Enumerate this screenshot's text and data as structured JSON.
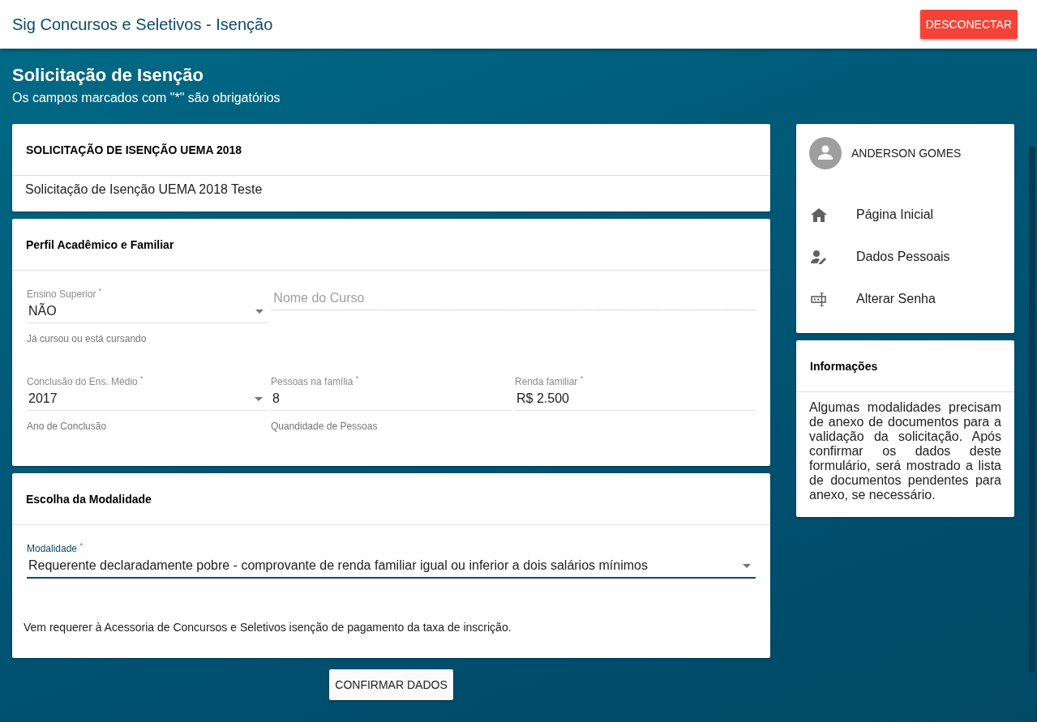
{
  "app_bar": {
    "title": "Sig Concursos e Seletivos - Isenção",
    "logout_button": "DESCONECTAR"
  },
  "page_header": {
    "title": "Solicitação de Isenção",
    "subtitle": "Os campos marcados com \"*\" são obrigatórios"
  },
  "request_card": {
    "title": "SOLICITAÇÃO DE ISENÇÃO UEMA 2018",
    "text": "Solicitação de Isenção UEMA 2018 Teste"
  },
  "profile_card": {
    "title": "Perfil Acadêmico e Familiar",
    "rows": [
      [
        {
          "kind": "select",
          "label": "Ensino Superior",
          "required_mark": "*",
          "value": "NÃO",
          "hint": "Já cursou ou está cursando",
          "disabled": false,
          "focused": false
        },
        {
          "kind": "text",
          "placeholder": "Nome do Curso",
          "disabled": true,
          "focused": false
        }
      ],
      [
        {
          "kind": "select",
          "label": "Conclusão do Ens. Médio",
          "required_mark": "*",
          "value": "2017",
          "hint": "Ano de Conclusão",
          "disabled": false,
          "focused": false
        },
        {
          "kind": "text",
          "label": "Pessoas na família",
          "required_mark": "*",
          "value": "8",
          "hint": "Quandidade de Pessoas",
          "disabled": false,
          "focused": false
        },
        {
          "kind": "text",
          "label": "Renda familiar",
          "required_mark": "*",
          "value": "R$ 2.500",
          "disabled": false,
          "focused": false
        }
      ]
    ]
  },
  "modality_card": {
    "title": "Escolha da Modalidade",
    "field": {
      "kind": "select",
      "label": "Modalidade",
      "required_mark": "*",
      "value": "Requerente declaradamente pobre - comprovante de renda familiar igual ou inferior a dois salários mínimos",
      "focused": true
    },
    "text": "Vem requerer à Acessoria de Concursos e Seletivos isenção de pagamento da taxa de inscrição."
  },
  "confirm_button": "CONFIRMAR DADOS",
  "user_card": {
    "name": "ANDERSON GOMES",
    "menu": [
      {
        "kind": "home",
        "label": "Página Inicial"
      },
      {
        "kind": "person-edit",
        "label": "Dados Pessoais"
      },
      {
        "kind": "password",
        "label": "Alterar Senha"
      }
    ]
  },
  "info_card": {
    "title": "Informações",
    "text": "Algumas modalidades precisam de anexo de documentos para a validação da solicitação. Após confirmar os dados deste formulário, será mostrado a lista de documentos pendentes para anexo, se necessário."
  }
}
